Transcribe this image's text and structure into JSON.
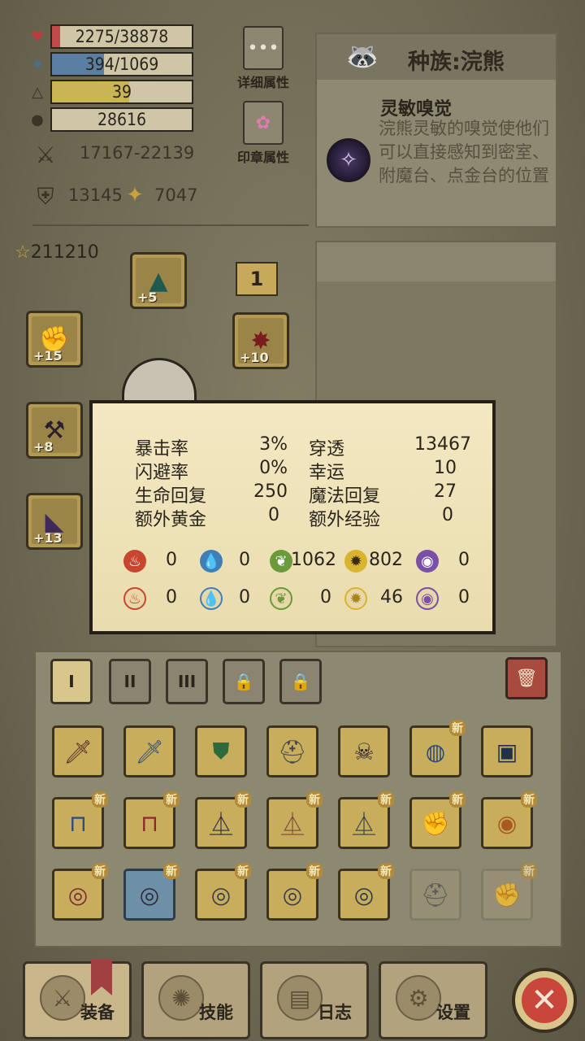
{
  "stats": {
    "hp": {
      "text": "2275/38878",
      "fraction": 0.058,
      "icon": "heart-icon",
      "color": "#c14b4b"
    },
    "mp": {
      "text": "394/1069",
      "fraction": 0.37,
      "icon": "mana-icon",
      "color": "#5a7fa3"
    },
    "level": {
      "text": "39",
      "fraction": 0.55,
      "icon": "level-icon",
      "color": "#c9b456"
    },
    "gold": {
      "text": "28616",
      "fraction": 0.0,
      "icon": "gold-icon",
      "color": "#c9b456"
    },
    "attack": {
      "text": "17167-22139",
      "icon": "swords-icon"
    },
    "defense": {
      "text": "13145",
      "icon": "shield-icon"
    },
    "magic": {
      "text": "7047",
      "icon": "wand-icon"
    }
  },
  "side_buttons": {
    "detail": {
      "label": "详细属性",
      "icon": "dots-icon"
    },
    "seal": {
      "label": "印章属性",
      "icon": "flower-seal-icon"
    }
  },
  "race": {
    "title": "种族:浣熊",
    "talent_name": "灵敏嗅觉",
    "talent_desc": "浣熊灵敏的嗅觉使他们可以直接感知到密室、附魔台、点金台的位置"
  },
  "equipment": {
    "score": "211210",
    "page": "1",
    "slots": [
      {
        "name": "hat-slot",
        "level": "+5",
        "icon": "witch-hat-icon"
      },
      {
        "name": "left-hand-slot",
        "level": "+15",
        "icon": "gauntlet-icon"
      },
      {
        "name": "right-hand-slot",
        "level": "+10",
        "icon": "spiked-armor-icon"
      },
      {
        "name": "weapon-slot",
        "level": "+8",
        "icon": "spiked-club-icon"
      },
      {
        "name": "cape-slot",
        "level": "+13",
        "icon": "wing-cape-icon"
      }
    ]
  },
  "tooltip": {
    "rows": [
      {
        "l_label": "暴击率",
        "l_val": "3%",
        "r_label": "穿透",
        "r_val": "13467"
      },
      {
        "l_label": "闪避率",
        "l_val": "0%",
        "r_label": "幸运",
        "r_val": "10"
      },
      {
        "l_label": "生命回复",
        "l_val": "250",
        "r_label": "魔法回复",
        "r_val": "27"
      },
      {
        "l_label": "额外黄金",
        "l_val": "0",
        "r_label": "额外经验",
        "r_val": "0"
      }
    ],
    "elements_attack": [
      "0",
      "0",
      "1062",
      "802",
      "0"
    ],
    "elements_resist": [
      "0",
      "0",
      "0",
      "46",
      "0"
    ],
    "element_icons": [
      "fire-icon",
      "water-icon",
      "leaf-icon",
      "lightning-icon",
      "arcane-icon"
    ]
  },
  "bag": {
    "tabs": [
      "I",
      "II",
      "III",
      "lock-icon",
      "lock-icon"
    ],
    "new_badge": "新",
    "items": [
      {
        "icon": "sword-icon",
        "style": "gold",
        "new": false
      },
      {
        "icon": "blue-sword-icon",
        "style": "gold",
        "new": false
      },
      {
        "icon": "green-shield-icon",
        "style": "gold",
        "new": false
      },
      {
        "icon": "helmet-icon",
        "style": "gold",
        "new": false
      },
      {
        "icon": "horned-helmet-icon",
        "style": "gold",
        "new": false
      },
      {
        "icon": "blue-helmet-icon",
        "style": "gold",
        "new": true
      },
      {
        "icon": "chest-armor-icon",
        "style": "gold",
        "new": false
      },
      {
        "icon": "blue-pants-icon",
        "style": "gold",
        "new": true
      },
      {
        "icon": "red-pants-icon",
        "style": "gold",
        "new": true
      },
      {
        "icon": "dark-boots-icon",
        "style": "gold",
        "new": true
      },
      {
        "icon": "leather-boots-icon",
        "style": "gold",
        "new": true
      },
      {
        "icon": "steel-boots-icon",
        "style": "gold",
        "new": true
      },
      {
        "icon": "gauntlet-icon",
        "style": "gold",
        "new": true
      },
      {
        "icon": "amulet-icon",
        "style": "gold",
        "new": true
      },
      {
        "icon": "red-ring-icon",
        "style": "gold",
        "new": true
      },
      {
        "icon": "blue-ring-icon",
        "style": "blue",
        "new": true
      },
      {
        "icon": "silver-ring-icon",
        "style": "gold",
        "new": true
      },
      {
        "icon": "dark-ring-icon",
        "style": "gold",
        "new": true
      },
      {
        "icon": "ring-icon",
        "style": "gold",
        "new": true
      },
      {
        "icon": "helmet-icon",
        "style": "faded",
        "new": false
      },
      {
        "icon": "gauntlet-icon",
        "style": "faded",
        "new": true
      }
    ]
  },
  "nav": {
    "equip": "装备",
    "skill": "技能",
    "log": "日志",
    "settings": "设置"
  }
}
